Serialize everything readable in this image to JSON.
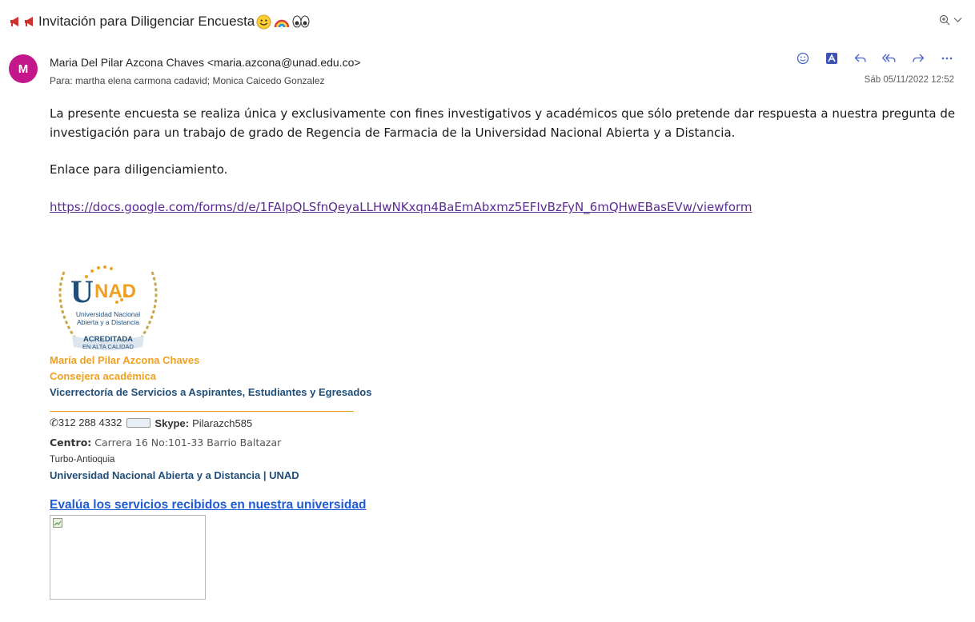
{
  "email": {
    "subject": "Invitación para Diligenciar Encuesta",
    "sender_initial": "M",
    "from": "Maria Del Pilar Azcona Chaves <maria.azcona@unad.edu.co>",
    "to": "Para:  martha elena carmona cadavid;  Monica Caicedo Gonzalez",
    "date": "Sáb 05/11/2022 12:52",
    "body_paragraph_1": "La presente encuesta se realiza única y exclusivamente con fines investigativos y académicos que sólo pretende dar respuesta a nuestra pregunta de investigación para  un trabajo de grado de  Regencia de Farmacia de la Universidad Nacional Abierta y a Distancia.",
    "body_paragraph_2": "Enlace para diligenciamiento.",
    "form_link": "https://docs.google.com/forms/d/e/1FAIpQLSfnQeyaLLHwNKxqn4BaEmAbxmz5EFIvBzFyN_6mQHwEBasEVw/viewform"
  },
  "signature": {
    "logo": {
      "wordmark": "UNAD",
      "line1": "Universidad Nacional",
      "line2": "Abierta y a Distancia",
      "badge1": "ACREDITADA",
      "badge2": "EN ALTA CALIDAD"
    },
    "name": "María del Pilar Azcona Chaves",
    "role": "Consejera académica",
    "department": "Vicerrectoría de Servicios a Aspirantes, Estudiantes y Egresados",
    "phone": "✆312 288 4332",
    "skype_label": "Skype:",
    "skype_user": "Pilarazch585",
    "centro_label": "Centro:",
    "centro_address": "Carrera 16 No:101-33 Barrio Baltazar",
    "city": "Turbo-Antioquia",
    "university": "Universidad Nacional Abierta y a Distancia | UNAD",
    "evaluation_link": "Evalúa los servicios recibidos en nuestra universidad"
  },
  "colors": {
    "avatar": "#c4178c",
    "accent_icons": "#4a63c8",
    "signature_orange": "#f0a020",
    "signature_blue": "#1f4e79",
    "link_visited": "#5b2c8e"
  },
  "icons": [
    "megaphone-icon",
    "smile-emoji-icon",
    "rainbow-emoji-icon",
    "eyes-emoji-icon",
    "zoom-icon",
    "chevron-down-icon",
    "emoji-reaction-icon",
    "pdf-app-icon",
    "reply-icon",
    "reply-all-icon",
    "forward-icon",
    "more-icon"
  ]
}
